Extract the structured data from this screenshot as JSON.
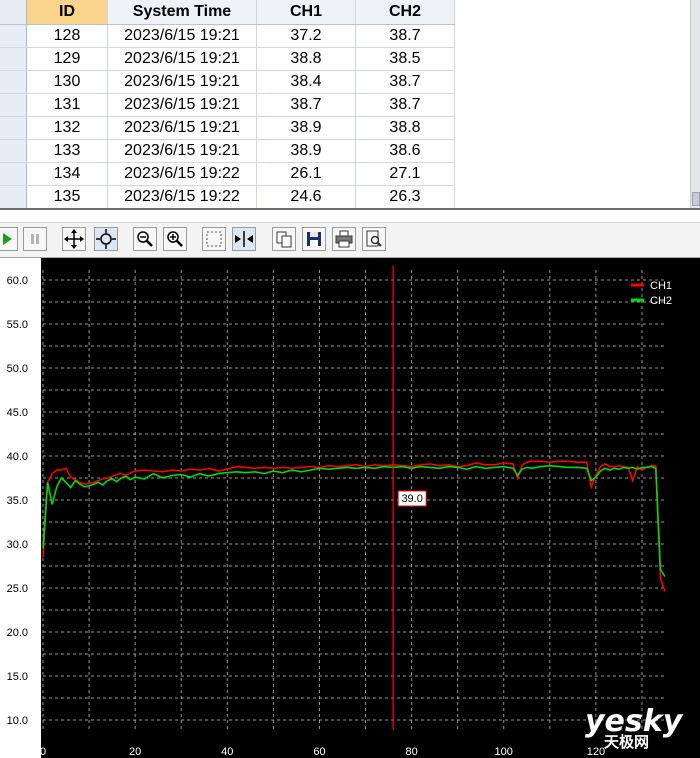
{
  "table": {
    "columns": [
      "ID",
      "System Time",
      "CH1",
      "CH2"
    ],
    "rows": [
      [
        "128",
        "2023/6/15 19:21",
        "37.2",
        "38.7"
      ],
      [
        "129",
        "2023/6/15 19:21",
        "38.8",
        "38.5"
      ],
      [
        "130",
        "2023/6/15 19:21",
        "38.4",
        "38.7"
      ],
      [
        "131",
        "2023/6/15 19:21",
        "38.7",
        "38.7"
      ],
      [
        "132",
        "2023/6/15 19:21",
        "38.9",
        "38.8"
      ],
      [
        "133",
        "2023/6/15 19:21",
        "38.9",
        "38.6"
      ],
      [
        "134",
        "2023/6/15 19:22",
        "26.1",
        "27.1"
      ],
      [
        "135",
        "2023/6/15 19:22",
        "24.6",
        "26.3"
      ]
    ]
  },
  "toolbar": {
    "buttons": [
      "play-icon",
      "pause-icon",
      "pan-icon",
      "zoom-fit-icon",
      "zoom-out-icon",
      "zoom-in-icon",
      "select-rect-icon",
      "cursor-split-icon",
      "copy-icon",
      "save-icon",
      "print-icon",
      "print-preview-icon"
    ]
  },
  "cursor": {
    "x": 76,
    "label": "39.0"
  },
  "watermark": {
    "brand": "yesky",
    "cn": "天极网"
  },
  "colors": {
    "ch1": "#ff0000",
    "ch2": "#00dd00",
    "cursor": "#ff0000",
    "grid": "#c8c8c8",
    "background": "#000000"
  },
  "chart_data": {
    "type": "line",
    "xlim": [
      0,
      135
    ],
    "ylim": [
      10,
      60
    ],
    "x_ticks": [
      "0",
      "20",
      "40",
      "60",
      "80",
      "100",
      "120"
    ],
    "y_ticks": [
      "60.0",
      "55.0",
      "50.0",
      "45.0",
      "40.0",
      "35.0",
      "30.0",
      "25.0",
      "20.0",
      "15.0",
      "10.0"
    ],
    "grid": true,
    "legend": "top-right",
    "series": [
      {
        "name": "CH1",
        "color": "#ff0000",
        "points": [
          [
            0,
            28.5
          ],
          [
            1,
            37.0
          ],
          [
            2,
            38.0
          ],
          [
            3,
            38.4
          ],
          [
            4,
            38.4
          ],
          [
            5,
            38.6
          ],
          [
            6,
            37.6
          ],
          [
            7,
            37.3
          ],
          [
            8,
            37.0
          ],
          [
            9,
            36.8
          ],
          [
            10,
            36.9
          ],
          [
            11,
            37.0
          ],
          [
            12,
            37.2
          ],
          [
            13,
            37.4
          ],
          [
            14,
            37.5
          ],
          [
            15,
            37.7
          ],
          [
            16,
            37.9
          ],
          [
            17,
            38.0
          ],
          [
            18,
            37.8
          ],
          [
            19,
            38.1
          ],
          [
            20,
            38.3
          ],
          [
            22,
            38.4
          ],
          [
            24,
            38.3
          ],
          [
            26,
            38.2
          ],
          [
            28,
            38.4
          ],
          [
            30,
            38.3
          ],
          [
            32,
            38.5
          ],
          [
            34,
            38.4
          ],
          [
            36,
            38.6
          ],
          [
            38,
            38.3
          ],
          [
            40,
            38.5
          ],
          [
            42,
            38.8
          ],
          [
            44,
            38.7
          ],
          [
            46,
            38.6
          ],
          [
            48,
            38.7
          ],
          [
            50,
            38.6
          ],
          [
            52,
            38.7
          ],
          [
            54,
            38.6
          ],
          [
            56,
            38.7
          ],
          [
            58,
            38.8
          ],
          [
            60,
            38.7
          ],
          [
            62,
            38.9
          ],
          [
            64,
            38.8
          ],
          [
            66,
            38.9
          ],
          [
            68,
            39.0
          ],
          [
            70,
            38.8
          ],
          [
            72,
            39.0
          ],
          [
            74,
            38.9
          ],
          [
            76,
            39.0
          ],
          [
            78,
            38.9
          ],
          [
            80,
            38.8
          ],
          [
            82,
            39.0
          ],
          [
            84,
            39.1
          ],
          [
            86,
            38.9
          ],
          [
            88,
            39.0
          ],
          [
            90,
            38.8
          ],
          [
            92,
            38.9
          ],
          [
            94,
            39.2
          ],
          [
            96,
            39.0
          ],
          [
            98,
            39.0
          ],
          [
            100,
            39.2
          ],
          [
            102,
            39.1
          ],
          [
            103,
            37.5
          ],
          [
            104,
            39.0
          ],
          [
            105,
            39.3
          ],
          [
            106,
            39.4
          ],
          [
            108,
            39.4
          ],
          [
            110,
            39.3
          ],
          [
            112,
            39.4
          ],
          [
            114,
            39.4
          ],
          [
            116,
            39.3
          ],
          [
            118,
            39.3
          ],
          [
            119,
            36.5
          ],
          [
            120,
            37.8
          ],
          [
            121,
            38.8
          ],
          [
            122,
            39.1
          ],
          [
            123,
            38.8
          ],
          [
            124,
            38.8
          ],
          [
            125,
            38.9
          ],
          [
            126,
            38.8
          ],
          [
            127,
            38.7
          ],
          [
            128,
            37.2
          ],
          [
            129,
            38.8
          ],
          [
            130,
            38.4
          ],
          [
            131,
            38.7
          ],
          [
            132,
            38.9
          ],
          [
            133,
            38.9
          ],
          [
            134,
            26.1
          ],
          [
            135,
            24.6
          ]
        ]
      },
      {
        "name": "CH2",
        "color": "#00dd00",
        "points": [
          [
            0,
            29.5
          ],
          [
            1,
            37.0
          ],
          [
            2,
            34.5
          ],
          [
            3,
            36.5
          ],
          [
            4,
            37.5
          ],
          [
            5,
            37.0
          ],
          [
            6,
            36.4
          ],
          [
            7,
            37.2
          ],
          [
            8,
            36.8
          ],
          [
            9,
            36.5
          ],
          [
            10,
            36.6
          ],
          [
            11,
            36.8
          ],
          [
            12,
            37.0
          ],
          [
            13,
            36.7
          ],
          [
            14,
            37.2
          ],
          [
            15,
            37.4
          ],
          [
            16,
            37.1
          ],
          [
            17,
            37.5
          ],
          [
            18,
            37.7
          ],
          [
            19,
            37.3
          ],
          [
            20,
            37.6
          ],
          [
            22,
            37.4
          ],
          [
            24,
            38.0
          ],
          [
            26,
            37.5
          ],
          [
            28,
            37.8
          ],
          [
            30,
            37.9
          ],
          [
            32,
            37.6
          ],
          [
            34,
            38.0
          ],
          [
            36,
            37.7
          ],
          [
            38,
            38.0
          ],
          [
            40,
            38.1
          ],
          [
            42,
            38.2
          ],
          [
            44,
            38.1
          ],
          [
            46,
            38.2
          ],
          [
            48,
            38.0
          ],
          [
            50,
            38.3
          ],
          [
            52,
            38.1
          ],
          [
            54,
            38.4
          ],
          [
            56,
            38.2
          ],
          [
            58,
            38.4
          ],
          [
            60,
            38.6
          ],
          [
            62,
            38.5
          ],
          [
            64,
            38.6
          ],
          [
            66,
            38.7
          ],
          [
            68,
            38.6
          ],
          [
            70,
            38.7
          ],
          [
            72,
            38.6
          ],
          [
            74,
            38.8
          ],
          [
            76,
            38.7
          ],
          [
            78,
            38.8
          ],
          [
            80,
            38.6
          ],
          [
            82,
            38.8
          ],
          [
            84,
            38.7
          ],
          [
            86,
            38.6
          ],
          [
            88,
            38.8
          ],
          [
            90,
            38.7
          ],
          [
            92,
            38.5
          ],
          [
            94,
            38.8
          ],
          [
            96,
            38.6
          ],
          [
            98,
            38.7
          ],
          [
            100,
            38.8
          ],
          [
            102,
            38.6
          ],
          [
            103,
            37.8
          ],
          [
            104,
            38.5
          ],
          [
            105,
            38.7
          ],
          [
            106,
            38.6
          ],
          [
            108,
            38.8
          ],
          [
            110,
            38.9
          ],
          [
            112,
            38.8
          ],
          [
            114,
            38.7
          ],
          [
            116,
            38.7
          ],
          [
            118,
            38.6
          ],
          [
            119,
            37.2
          ],
          [
            120,
            37.6
          ],
          [
            121,
            38.3
          ],
          [
            122,
            38.6
          ],
          [
            123,
            38.4
          ],
          [
            124,
            38.6
          ],
          [
            125,
            38.5
          ],
          [
            126,
            38.7
          ],
          [
            127,
            38.6
          ],
          [
            128,
            38.7
          ],
          [
            129,
            38.5
          ],
          [
            130,
            38.7
          ],
          [
            131,
            38.7
          ],
          [
            132,
            38.8
          ],
          [
            133,
            38.6
          ],
          [
            134,
            27.1
          ],
          [
            135,
            26.3
          ]
        ]
      }
    ]
  }
}
